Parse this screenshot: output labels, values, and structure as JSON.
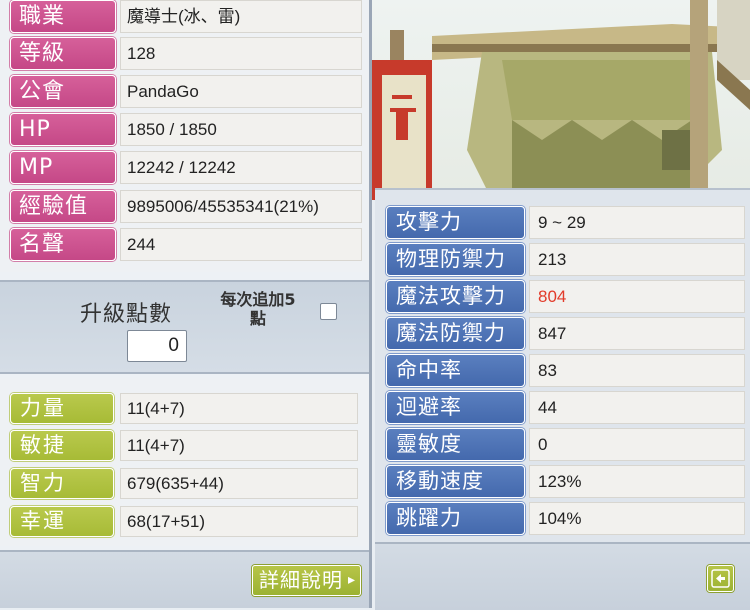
{
  "profile": {
    "rows": [
      {
        "label": "職業",
        "value": "魔導士(冰、雷)"
      },
      {
        "label": "等級",
        "value": "128"
      },
      {
        "label": "公會",
        "value": "PandaGo"
      },
      {
        "label": "HP",
        "value": "1850 / 1850"
      },
      {
        "label": "MP",
        "value": "12242 / 12242"
      },
      {
        "label": "經驗值",
        "value": "9895006/45535341(21%)"
      },
      {
        "label": "名聲",
        "value": "244"
      }
    ]
  },
  "levelup": {
    "title": "升級點數",
    "points": "0",
    "auto_add_label": "每次追加5點",
    "auto_add_checked": false
  },
  "abilities": {
    "rows": [
      {
        "label": "力量",
        "value": "11(4+7)"
      },
      {
        "label": "敏捷",
        "value": "11(4+7)"
      },
      {
        "label": "智力",
        "value": "679(635+44)"
      },
      {
        "label": "幸運",
        "value": "68(17+51)"
      }
    ]
  },
  "detail_button": {
    "label": "詳細說明"
  },
  "combat": {
    "rows": [
      {
        "label": "攻擊力",
        "value": "9 ~ 29"
      },
      {
        "label": "物理防禦力",
        "value": "213"
      },
      {
        "label": "魔法攻擊力",
        "value": "804"
      },
      {
        "label": "魔法防禦力",
        "value": "847"
      },
      {
        "label": "命中率",
        "value": "83"
      },
      {
        "label": "迴避率",
        "value": "44"
      },
      {
        "label": "靈敏度",
        "value": "0"
      },
      {
        "label": "移動速度",
        "value": "123%"
      },
      {
        "label": "跳躍力",
        "value": "104%"
      }
    ],
    "highlight_color": "#e23b2a"
  },
  "back_button": {
    "icon": "arrow-left-icon"
  }
}
